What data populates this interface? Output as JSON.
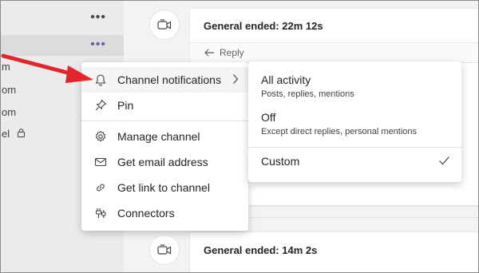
{
  "sidebar": {
    "row_fragments": [
      "m",
      "om",
      "om",
      "el"
    ]
  },
  "feed": {
    "meeting1_title": "General ended: 22m 12s",
    "reply_label": "Reply",
    "meeting2_title": "General ended: 14m 2s"
  },
  "context_menu": {
    "items": [
      {
        "label": "Channel notifications",
        "icon": "bell-icon",
        "has_submenu": true
      },
      {
        "label": "Pin",
        "icon": "pin-icon"
      },
      {
        "label": "Manage channel",
        "icon": "gear-icon"
      },
      {
        "label": "Get email address",
        "icon": "mail-icon"
      },
      {
        "label": "Get link to channel",
        "icon": "link-icon"
      },
      {
        "label": "Connectors",
        "icon": "connectors-icon"
      }
    ]
  },
  "notifications_submenu": {
    "options": [
      {
        "title": "All activity",
        "description": "Posts, replies, mentions"
      },
      {
        "title": "Off",
        "description": "Except direct replies, personal mentions"
      },
      {
        "title": "Custom",
        "description": "",
        "selected": true
      }
    ]
  },
  "colors": {
    "accent": "#6264a7",
    "annotation_arrow": "#e3242b"
  }
}
